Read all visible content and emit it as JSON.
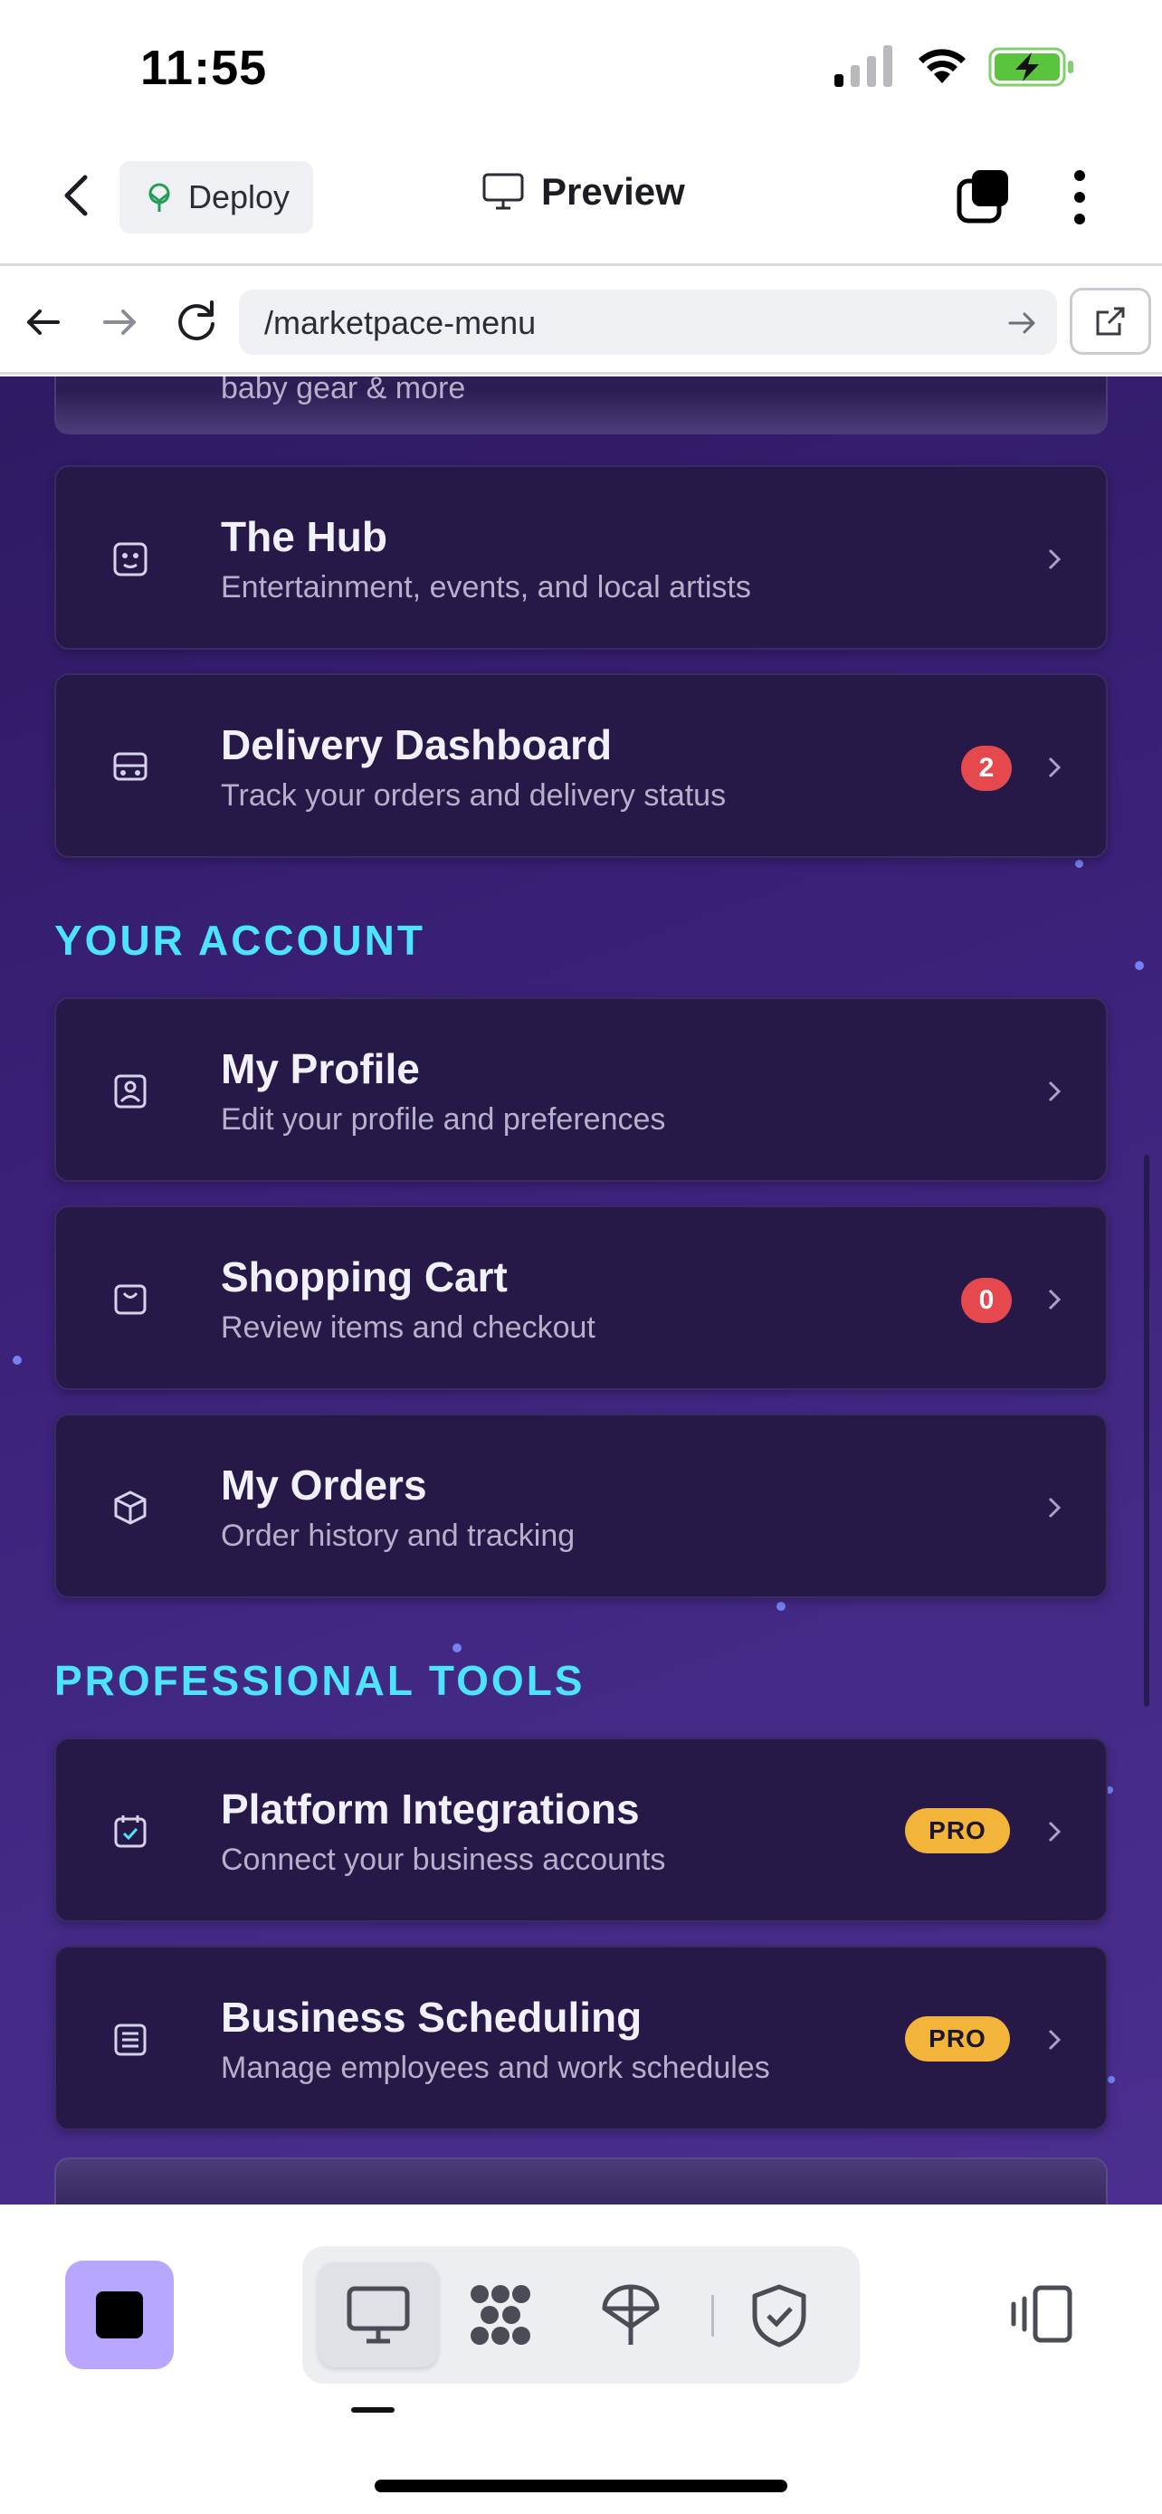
{
  "status_bar": {
    "time": "11:55"
  },
  "header": {
    "back_icon": "chevron-left-icon",
    "deploy_label": "Deploy",
    "preview_label": "Preview"
  },
  "browser": {
    "url": "/marketpace-menu"
  },
  "accent": {
    "section_title_color": "#4de3ff",
    "badge_red": "#e5484d",
    "badge_pro": "#f3b43a",
    "stop_button": "#b9a7ff"
  },
  "content": {
    "partial_top_subtitle": "baby gear & more",
    "cards_top": [
      {
        "icon": "robot-face-icon",
        "title": "The Hub",
        "subtitle": "Entertainment, events, and local artists"
      },
      {
        "icon": "delivery-van-icon",
        "title": "Delivery Dashboard",
        "subtitle": "Track your orders and delivery status",
        "badge": "2"
      }
    ],
    "section_account": "YOUR ACCOUNT",
    "cards_account": [
      {
        "icon": "profile-card-icon",
        "title": "My Profile",
        "subtitle": "Edit your profile and preferences"
      },
      {
        "icon": "shopping-bag-icon",
        "title": "Shopping Cart",
        "subtitle": "Review items and checkout",
        "badge": "0"
      },
      {
        "icon": "box-icon",
        "title": "My Orders",
        "subtitle": "Order history and tracking"
      }
    ],
    "section_pro": "PROFESSIONAL TOOLS",
    "cards_pro": [
      {
        "icon": "integration-icon",
        "title": "Platform Integrations",
        "subtitle": "Connect your business accounts",
        "badge": "PRO"
      },
      {
        "icon": "schedule-list-icon",
        "title": "Business Scheduling",
        "subtitle": "Manage employees and work schedules",
        "badge": "PRO"
      }
    ]
  },
  "toolbar": {
    "items": [
      "monitor-icon",
      "network-icon",
      "deploy-icon",
      "shield-check-icon"
    ]
  }
}
